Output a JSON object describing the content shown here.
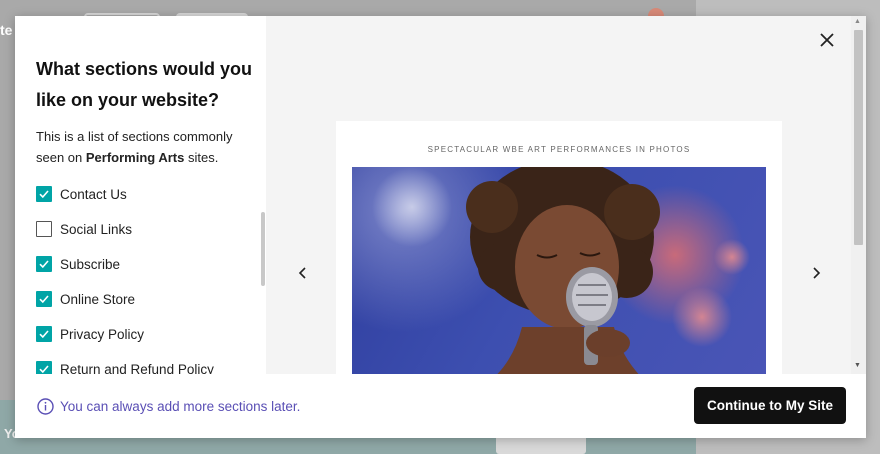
{
  "modal": {
    "heading": "What sections would you like on your website?",
    "description_prefix": "This is a list of sections commonly seen on ",
    "description_bold": "Performing Arts",
    "description_suffix": " sites.",
    "options": [
      {
        "label": "Contact Us",
        "checked": true
      },
      {
        "label": "Social Links",
        "checked": false
      },
      {
        "label": "Subscribe",
        "checked": true
      },
      {
        "label": "Online Store",
        "checked": true
      },
      {
        "label": "Privacy Policy",
        "checked": true
      },
      {
        "label": "Return and Refund Policy",
        "checked": true
      }
    ],
    "preview_title": "SPECTACULAR WBE ART PERFORMANCES IN PHOTOS",
    "footer_info": "You can always add more sections later.",
    "continue_label": "Continue to My Site"
  },
  "background": {
    "left_fragment": "te",
    "bottom_fragment": "Yo"
  },
  "colors": {
    "accent_teal": "#00a4a6",
    "info_purple": "#5a4fb5",
    "button_black": "#111111"
  }
}
